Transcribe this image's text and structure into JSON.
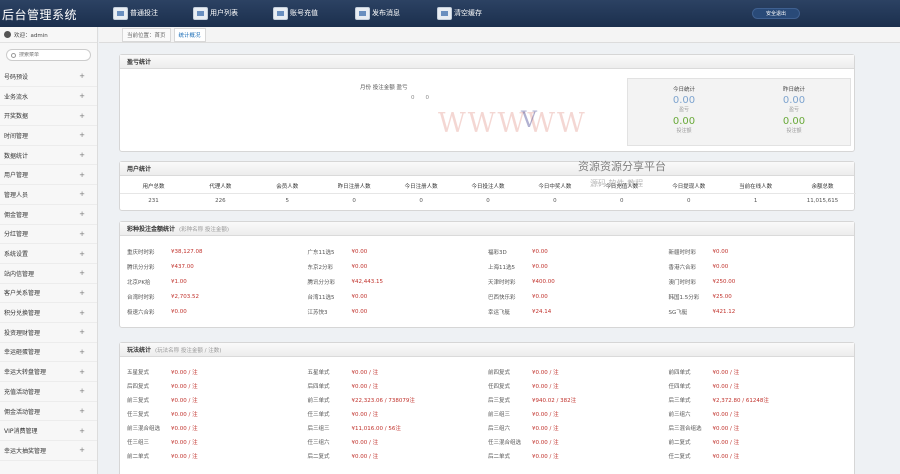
{
  "header": {
    "logo": "后台管理系统",
    "nav": [
      "普通投注",
      "用户列表",
      "账号充值",
      "发布消息",
      "清空缓存"
    ],
    "logout": "安全退出"
  },
  "sidebar": {
    "welcome": "欢迎：admin",
    "search_placeholder": "搜索菜单",
    "items": [
      "号码预设",
      "业务流水",
      "开奖数据",
      "时间管理",
      "数据统计",
      "用户管理",
      "管理人员",
      "佣金管理",
      "分红管理",
      "系统设置",
      "站内信管理",
      "客户关系管理",
      "积分兑换管理",
      "投资理财管理",
      "幸运砸蛋管理",
      "幸运大转盘管理",
      "充值活动管理",
      "佣金活动管理",
      "VIP消费管理",
      "幸运大抽奖管理"
    ]
  },
  "breadcrumb": {
    "label": "当前位置：首页",
    "current": "统计概况"
  },
  "profit": {
    "title": "盈亏统计",
    "center_label": "月份  投注金额  盈亏",
    "zeros": [
      "0",
      "0"
    ],
    "today": {
      "title": "今日统计",
      "v1": "0.00",
      "l1": "盈亏",
      "v2": "0.00",
      "l2": "投注额"
    },
    "yesterday": {
      "title": "昨日统计",
      "v1": "0.00",
      "l1": "盈亏",
      "v2": "0.00",
      "l2": "投注额"
    }
  },
  "users": {
    "title": "用户统计",
    "headers": [
      "用户总数",
      "代理人数",
      "会员人数",
      "昨日注册人数",
      "今日注册人数",
      "今日投注人数",
      "今日中奖人数",
      "今日充值人数",
      "今日提现人数",
      "当前在线人数",
      "余额总数"
    ],
    "values": [
      "231",
      "226",
      "5",
      "0",
      "0",
      "0",
      "0",
      "0",
      "0",
      "1",
      "11,015,615"
    ]
  },
  "lottery": {
    "title": "彩种投注金额统计",
    "subtitle": "(彩种名称  投注金额)",
    "rows": [
      [
        "重庆时时彩",
        "¥38,127.08",
        "广东11选5",
        "¥0.00",
        "福彩3D",
        "¥0.00",
        "新疆时时彩",
        "¥0.00"
      ],
      [
        "腾讯分分彩",
        "¥437.00",
        "东京2分彩",
        "¥0.00",
        "上海11选5",
        "¥0.00",
        "香港六合彩",
        "¥0.00"
      ],
      [
        "北京PK拾",
        "¥1.00",
        "腾讯分分彩",
        "¥42,443.15",
        "天津时时彩",
        "¥400.00",
        "澳门时时彩",
        "¥250.00"
      ],
      [
        "台湾时时彩",
        "¥2,703.52",
        "台湾11选5",
        "¥0.00",
        "巴西快乐彩",
        "¥0.00",
        "韩国1.5分彩",
        "¥25.00"
      ],
      [
        "极速六合彩",
        "¥0.00",
        "江苏快3",
        "¥0.00",
        "幸运飞艇",
        "¥24.14",
        "SG飞艇",
        "¥421.12"
      ]
    ]
  },
  "play": {
    "title": "玩法统计",
    "subtitle": "(玩法名称  投注金额 / 注数)",
    "rows": [
      [
        "五星复式",
        "¥0.00 / 注",
        "五星单式",
        "¥0.00 / 注",
        "前四复式",
        "¥0.00 / 注",
        "前四单式",
        "¥0.00 / 注"
      ],
      [
        "后四复式",
        "¥0.00 / 注",
        "后四单式",
        "¥0.00 / 注",
        "任四复式",
        "¥0.00 / 注",
        "任四单式",
        "¥0.00 / 注"
      ],
      [
        "前三复式",
        "¥0.00 / 注",
        "前三单式",
        "¥22,323.06 / 738079注",
        "后三复式",
        "¥940.02 / 382注",
        "后三单式",
        "¥2,372.80 / 61248注"
      ],
      [
        "任三复式",
        "¥0.00 / 注",
        "任三单式",
        "¥0.00 / 注",
        "前三组三",
        "¥0.00 / 注",
        "前三组六",
        "¥0.00 / 注"
      ],
      [
        "前三混合组选",
        "¥0.00 / 注",
        "后三组三",
        "¥11,016.00 / 56注",
        "后三组六",
        "¥0.00 / 注",
        "后三混合组选",
        "¥0.00 / 注"
      ],
      [
        "任三组三",
        "¥0.00 / 注",
        "任三组六",
        "¥0.00 / 注",
        "任三混合组选",
        "¥0.00 / 注",
        "前二复式",
        "¥0.00 / 注"
      ],
      [
        "前二单式",
        "¥0.00 / 注",
        "后二复式",
        "¥0.00 / 注",
        "后二单式",
        "¥0.00 / 注",
        "任二复式",
        "¥0.00 / 注"
      ]
    ]
  },
  "watermark": {
    "url": "WWWWW",
    "mark": "V",
    "cn": "资源资源分享平台",
    "cn2": "源码 软件 教程"
  }
}
